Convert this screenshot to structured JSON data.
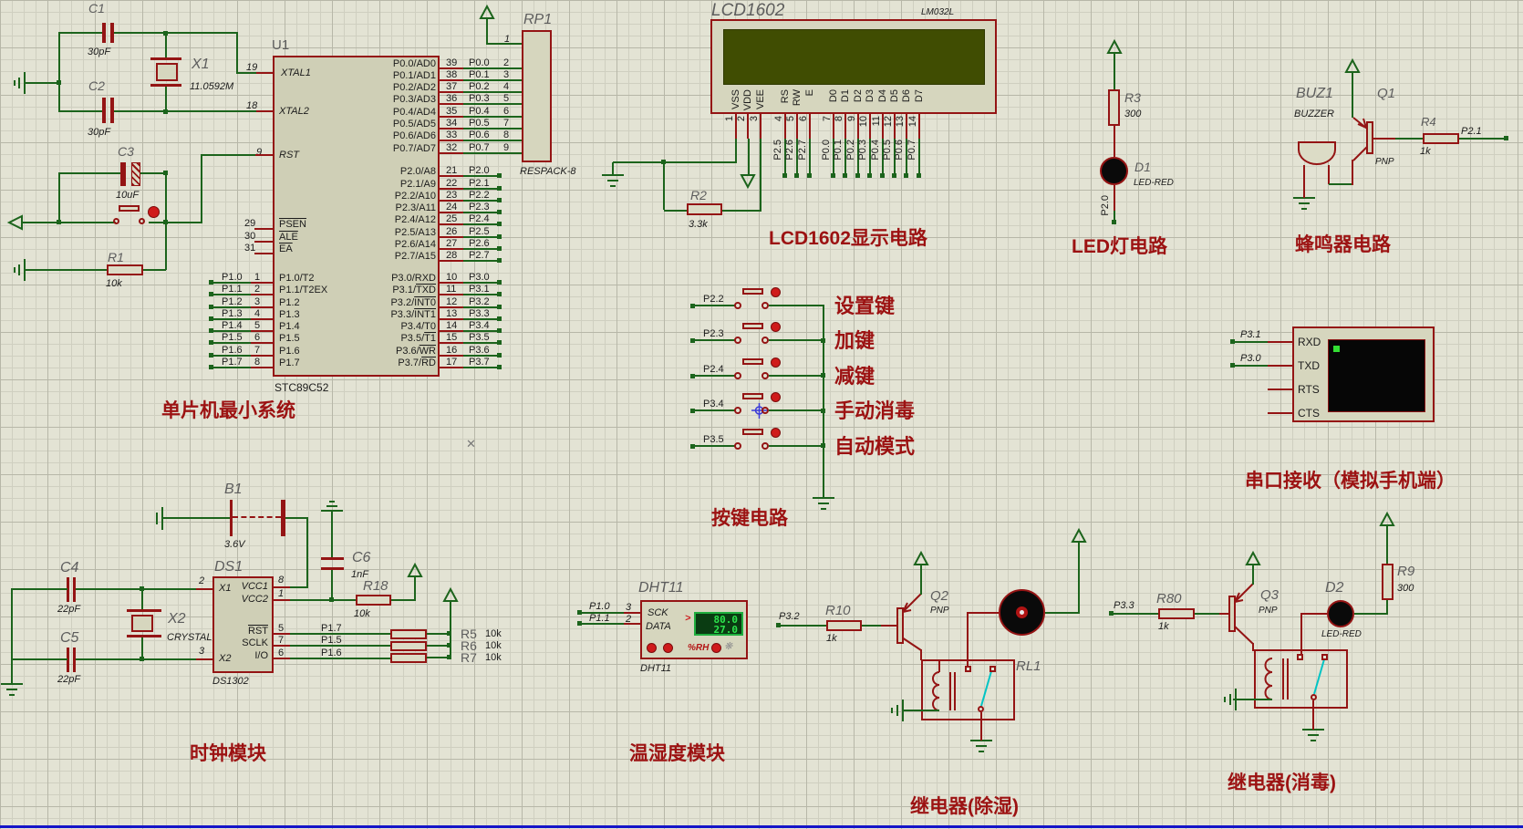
{
  "colors": {
    "wire_green": "#1c641c",
    "component_red": "#941414",
    "caption_red": "#9c1212",
    "grid_bg": "#e3e3d4",
    "lcd_screen": "#404d02",
    "terminal_screen": "#060606",
    "terminal_cursor": "#33dd33",
    "dht_digits": "#2de54d",
    "switch_cyan": "#00c4c4"
  },
  "captions": {
    "mcu": "单片机最小系统",
    "lcd": "LCD1602显示电路",
    "led": "LED灯电路",
    "buzzer": "蜂鸣器电路",
    "keys": "按键电路",
    "serial": "串口接收（模拟手机端）",
    "clock": "时钟模块",
    "dht": "温湿度模块",
    "relay1": "继电器(除湿)",
    "relay2": "继电器(消毒)"
  },
  "mcu": {
    "ref": "U1",
    "part": "STC89C52",
    "xtal1": {
      "num": "19",
      "name": "XTAL1"
    },
    "xtal2": {
      "num": "18",
      "name": "XTAL2"
    },
    "rst": {
      "num": "9",
      "name": "RST"
    },
    "ctrl_pins": [
      {
        "num": "29",
        "ov": "PSEN"
      },
      {
        "num": "30",
        "ov": "ALE"
      },
      {
        "num": "31",
        "ov": "EA"
      }
    ],
    "p1_pins": [
      {
        "num": "1",
        "name": "P1.0/T2",
        "net": "P1.0"
      },
      {
        "num": "2",
        "name": "P1.1/T2EX",
        "net": "P1.1"
      },
      {
        "num": "3",
        "name": "P1.2",
        "net": "P1.2"
      },
      {
        "num": "4",
        "name": "P1.3",
        "net": "P1.3"
      },
      {
        "num": "5",
        "name": "P1.4",
        "net": "P1.4"
      },
      {
        "num": "6",
        "name": "P1.5",
        "net": "P1.5"
      },
      {
        "num": "7",
        "name": "P1.6",
        "net": "P1.6"
      },
      {
        "num": "8",
        "name": "P1.7",
        "net": "P1.7"
      }
    ],
    "p0_pins": [
      {
        "num": "39",
        "name": "P0.0/AD0",
        "net": "P0.0",
        "rp": "2"
      },
      {
        "num": "38",
        "name": "P0.1/AD1",
        "net": "P0.1",
        "rp": "3"
      },
      {
        "num": "37",
        "name": "P0.2/AD2",
        "net": "P0.2",
        "rp": "4"
      },
      {
        "num": "36",
        "name": "P0.3/AD3",
        "net": "P0.3",
        "rp": "5"
      },
      {
        "num": "35",
        "name": "P0.4/AD4",
        "net": "P0.4",
        "rp": "6"
      },
      {
        "num": "34",
        "name": "P0.5/AD5",
        "net": "P0.5",
        "rp": "7"
      },
      {
        "num": "33",
        "name": "P0.6/AD6",
        "net": "P0.6",
        "rp": "8"
      },
      {
        "num": "32",
        "name": "P0.7/AD7",
        "net": "P0.7",
        "rp": "9"
      }
    ],
    "p2_pins": [
      {
        "num": "21",
        "name": "P2.0/A8",
        "net": "P2.0"
      },
      {
        "num": "22",
        "name": "P2.1/A9",
        "net": "P2.1"
      },
      {
        "num": "23",
        "name": "P2.2/A10",
        "net": "P2.2"
      },
      {
        "num": "24",
        "name": "P2.3/A11",
        "net": "P2.3"
      },
      {
        "num": "25",
        "name": "P2.4/A12",
        "net": "P2.4"
      },
      {
        "num": "26",
        "name": "P2.5/A13",
        "net": "P2.5"
      },
      {
        "num": "27",
        "name": "P2.6/A14",
        "net": "P2.6"
      },
      {
        "num": "28",
        "name": "P2.7/A15",
        "net": "P2.7"
      }
    ],
    "p3_pins": [
      {
        "num": "10",
        "pre": "P3.0/RXD",
        "ov": "",
        "net": "P3.0"
      },
      {
        "num": "11",
        "pre": "P3.1/",
        "ov": "TXD",
        "net": "P3.1"
      },
      {
        "num": "12",
        "pre": "P3.2/",
        "ov": "INT0",
        "net": "P3.2"
      },
      {
        "num": "13",
        "pre": "P3.3/",
        "ov": "INT1",
        "net": "P3.3"
      },
      {
        "num": "14",
        "pre": "P3.4/T0",
        "ov": "",
        "net": "P3.4"
      },
      {
        "num": "15",
        "pre": "P3.5/",
        "ov": "T1",
        "net": "P3.5"
      },
      {
        "num": "16",
        "pre": "P3.6/",
        "ov": "WR",
        "net": "P3.6"
      },
      {
        "num": "17",
        "pre": "P3.7/",
        "ov": "RD",
        "net": "P3.7"
      }
    ]
  },
  "osc": {
    "c1_ref": "C1",
    "c1_val": "30pF",
    "c2_ref": "C2",
    "c2_val": "30pF",
    "x1_ref": "X1",
    "x1_val": "11.0592M"
  },
  "reset": {
    "c3_ref": "C3",
    "c3_val": "10uF",
    "r1_ref": "R1",
    "r1_val": "10k"
  },
  "rp1": {
    "ref": "RP1",
    "part": "RESPACK-8",
    "pin1": "1"
  },
  "lcd": {
    "ref": "LCD1602",
    "part": "LM032L",
    "r2_ref": "R2",
    "r2_val": "3.3k",
    "pin_groups": [
      {
        "pins": [
          {
            "num": "1",
            "name": "VSS",
            "net": ""
          },
          {
            "num": "2",
            "name": "VDD",
            "net": ""
          },
          {
            "num": "3",
            "name": "VEE",
            "net": ""
          }
        ]
      },
      {
        "pins": [
          {
            "num": "4",
            "name": "RS",
            "net": "P2.5"
          },
          {
            "num": "5",
            "name": "RW",
            "net": "P2.6"
          },
          {
            "num": "6",
            "name": "E",
            "net": "P2.7"
          }
        ]
      },
      {
        "pins": [
          {
            "num": "7",
            "name": "D0",
            "net": "P0.0"
          },
          {
            "num": "8",
            "name": "D1",
            "net": "P0.1"
          },
          {
            "num": "9",
            "name": "D2",
            "net": "P0.2"
          },
          {
            "num": "10",
            "name": "D3",
            "net": "P0.3"
          },
          {
            "num": "11",
            "name": "D4",
            "net": "P0.4"
          },
          {
            "num": "12",
            "name": "D5",
            "net": "P0.5"
          },
          {
            "num": "13",
            "name": "D6",
            "net": "P0.6"
          },
          {
            "num": "14",
            "name": "D7",
            "net": "P0.7"
          }
        ]
      }
    ]
  },
  "led": {
    "r3_ref": "R3",
    "r3_val": "300",
    "d1_ref": "D1",
    "d1_part": "LED-RED",
    "net": "P2.0"
  },
  "buzzer": {
    "ref": "BUZ1",
    "part": "BUZZER",
    "q_ref": "Q1",
    "q_type": "PNP",
    "r4_ref": "R4",
    "r4_val": "1k",
    "net": "P2.1"
  },
  "keys": {
    "rows": [
      {
        "net": "P2.2",
        "label": "设置键"
      },
      {
        "net": "P2.3",
        "label": "加键"
      },
      {
        "net": "P2.4",
        "label": "减键"
      },
      {
        "net": "P3.4",
        "label": "手动消毒"
      },
      {
        "net": "P3.5",
        "label": "自动模式"
      }
    ]
  },
  "serial": {
    "pins": [
      {
        "name": "RXD",
        "net": "P3.1"
      },
      {
        "name": "TXD",
        "net": "P3.0"
      },
      {
        "name": "RTS",
        "net": ""
      },
      {
        "name": "CTS",
        "net": ""
      }
    ]
  },
  "clock": {
    "b1_ref": "B1",
    "b1_val": "3.6V",
    "ds_ref": "DS1",
    "ds_part": "DS1302",
    "x1_pin": {
      "num": "2",
      "name": "X1"
    },
    "x2_pin": {
      "num": "3",
      "name": "X2"
    },
    "vcc1": {
      "num": "8",
      "name": "VCC1"
    },
    "vcc2": {
      "num": "1",
      "name": "VCC2"
    },
    "sig_pins": [
      {
        "num": "5",
        "pre": "",
        "ov": "RST",
        "net": "P1.7"
      },
      {
        "num": "7",
        "pre": "SCLK",
        "ov": "",
        "net": "P1.5"
      },
      {
        "num": "6",
        "pre": "I/O",
        "ov": "",
        "net": "P1.6"
      }
    ],
    "c4_ref": "C4",
    "c4_val": "22pF",
    "c5_ref": "C5",
    "c5_val": "22pF",
    "x2_ref": "X2",
    "x2_part": "CRYSTAL",
    "c6_ref": "C6",
    "c6_val": "1nF",
    "r18_ref": "R18",
    "r18_val": "10k",
    "pullups": [
      {
        "ref": "R5",
        "val": "10k"
      },
      {
        "ref": "R6",
        "val": "10k"
      },
      {
        "ref": "R7",
        "val": "10k"
      }
    ]
  },
  "dht": {
    "ref": "DHT11",
    "part": "DHT11",
    "pins": [
      {
        "num": "3",
        "name": "SCK",
        "net": "P1.0"
      },
      {
        "num": "2",
        "name": "DATA",
        "net": "P1.1"
      }
    ],
    "display_line1": "80.0",
    "display_line2": "27.0",
    "rh": "%RH"
  },
  "relay1": {
    "net": "P3.2",
    "r_ref": "R10",
    "r_val": "1k",
    "q_ref": "Q2",
    "q_type": "PNP",
    "relay_ref": "RL1"
  },
  "relay2": {
    "net": "P3.3",
    "r_ref": "R80",
    "r_val": "1k",
    "q_ref": "Q3",
    "q_type": "PNP",
    "d_ref": "D2",
    "d_part": "LED-RED",
    "r9_ref": "R9",
    "r9_val": "300"
  }
}
